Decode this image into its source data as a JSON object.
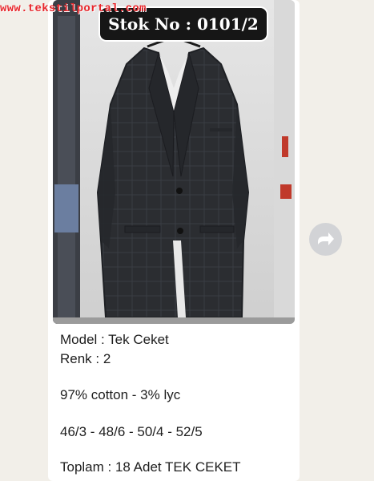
{
  "watermark": "www.tekstilportal.com",
  "badge": {
    "stock_no": "Stok No : 0101/2"
  },
  "photo": {
    "subject": "jacket-photo"
  },
  "caption": {
    "model": "Model : Tek Ceket",
    "color": "Renk : 2",
    "fabric": "97% cotton - 3% lyc",
    "sizes": "46/3 - 48/6 - 50/4 - 52/5",
    "total": "Toplam : 18 Adet TEK CEKET"
  },
  "actions": {
    "forward_icon": "forward-share-icon"
  },
  "colors": {
    "background": "#f2efe9",
    "card": "#ffffff",
    "badge": "#161616",
    "watermark": "#e8262b",
    "jacket": "#2b2d31",
    "forward_button": "#d2d3d6"
  }
}
